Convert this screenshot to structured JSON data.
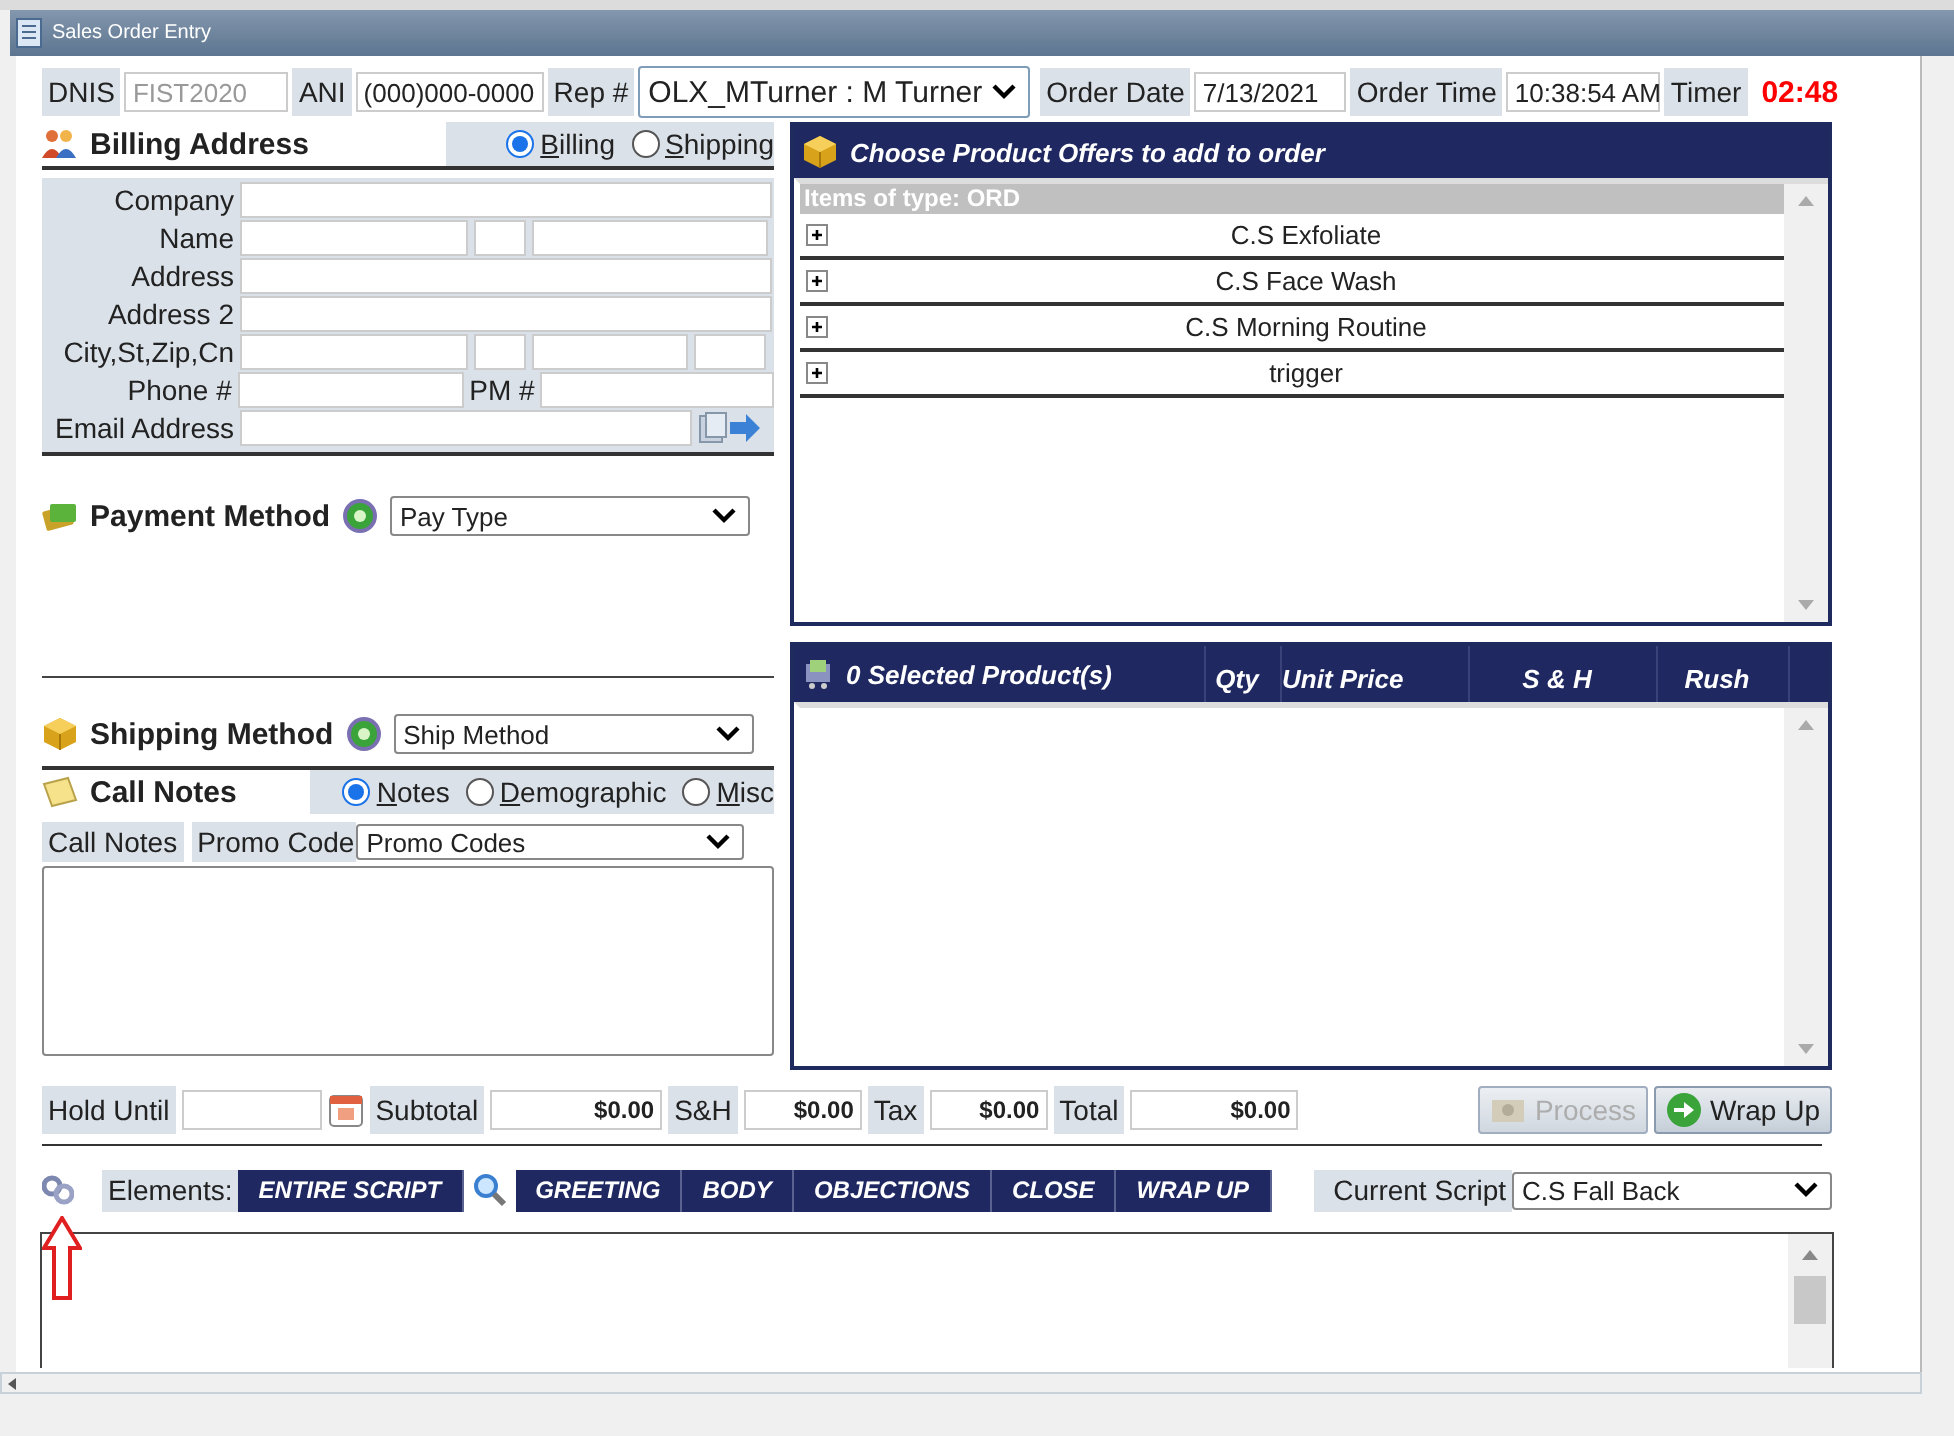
{
  "window": {
    "title": "Sales Order Entry"
  },
  "header": {
    "dnis_label": "DNIS",
    "dnis": {
      "value": "FIST2020",
      "disabled": true
    },
    "ani_label": "ANI",
    "ani": "(000)000-0000",
    "rep_label": "Rep #",
    "rep": "OLX_MTurner : M Turner",
    "order_date_label": "Order Date",
    "order_date": "7/13/2021",
    "order_time_label": "Order Time",
    "order_time": "10:38:54 AM",
    "timer_label": "Timer",
    "timer": "02:48"
  },
  "billing": {
    "title": "Billing Address",
    "address_types": [
      {
        "label": "Billing",
        "selected": true
      },
      {
        "label": "Shipping",
        "selected": false
      }
    ],
    "fields": [
      {
        "label": "Company",
        "kind": "single"
      },
      {
        "label": "Name",
        "kind": "name"
      },
      {
        "label": "Address",
        "kind": "single"
      },
      {
        "label": "Address 2",
        "kind": "single"
      },
      {
        "label": "City,St,Zip,Cn",
        "kind": "city"
      },
      {
        "label": "Phone #",
        "kind": "phone",
        "second_label": "PM #"
      },
      {
        "label": "Email Address",
        "kind": "email"
      }
    ]
  },
  "payment": {
    "title": "Payment Method",
    "select": "Pay Type"
  },
  "shipping": {
    "title": "Shipping Method",
    "select": "Ship Method"
  },
  "call_notes": {
    "title": "Call Notes",
    "tabs": [
      {
        "label": "Notes",
        "selected": true
      },
      {
        "label": "Demographic",
        "selected": false
      },
      {
        "label": "Misc",
        "selected": false
      }
    ],
    "notes_label": "Call Notes",
    "promo_label": "Promo Code",
    "promo_select": "Promo Codes"
  },
  "offers": {
    "title": "Choose Product Offers to add to order",
    "group": "Items of type: ORD",
    "items": [
      "C.S Exfoliate",
      "C.S Face Wash",
      "C.S Morning Routine",
      "trigger"
    ]
  },
  "selected_products": {
    "title": "0 Selected Product(s)",
    "columns": [
      "Qty",
      "Unit Price",
      "S & H",
      "Rush"
    ]
  },
  "totals": {
    "hold_until_label": "Hold Until",
    "subtotal_label": "Subtotal",
    "subtotal": "$0.00",
    "sh_label": "S&H",
    "sh": "$0.00",
    "tax_label": "Tax",
    "tax": "$0.00",
    "total_label": "Total",
    "total": "$0.00"
  },
  "actions": [
    {
      "label": "Process",
      "disabled": true,
      "kind": "process"
    },
    {
      "label": "Wrap Up",
      "disabled": false,
      "kind": "wrap"
    }
  ],
  "script": {
    "elements_label": "Elements:",
    "entire": "ENTIRE SCRIPT",
    "sections": [
      "GREETING",
      "BODY",
      "OBJECTIONS",
      "CLOSE",
      "WRAP UP"
    ],
    "current_label": "Current Script",
    "current": "C.S Fall Back"
  }
}
